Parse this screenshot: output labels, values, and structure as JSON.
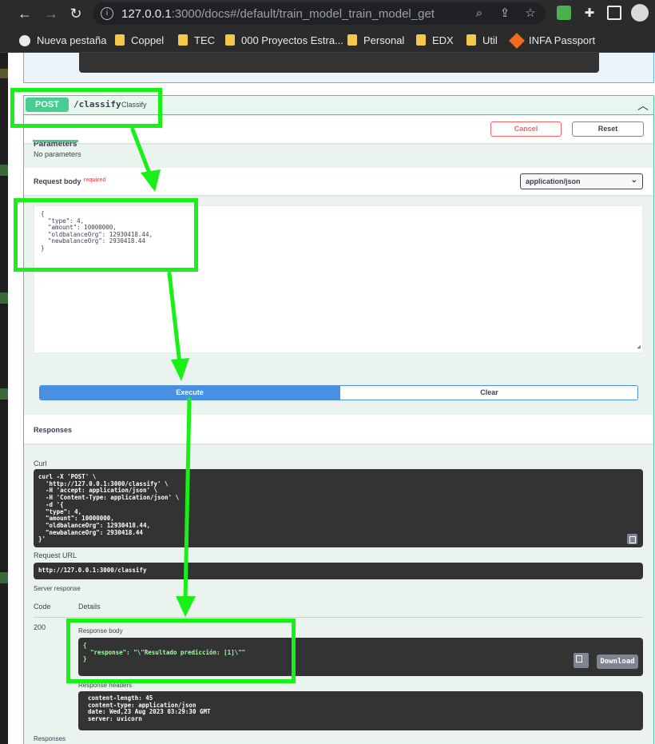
{
  "browser": {
    "url_host": "127.0.0.1",
    "url_rest": ":3000/docs#/default/train_model_train_model_get",
    "bookmarks": [
      {
        "label": "Nueva pestaña",
        "icon": "globe-icon"
      },
      {
        "label": "Coppel",
        "icon": "folder-icon"
      },
      {
        "label": "TEC",
        "icon": "folder-icon"
      },
      {
        "label": "000 Proyectos Estra...",
        "icon": "folder-icon"
      },
      {
        "label": "Personal",
        "icon": "folder-icon"
      },
      {
        "label": "EDX",
        "icon": "folder-icon"
      },
      {
        "label": "Util",
        "icon": "folder-icon"
      },
      {
        "label": "INFA Passport",
        "icon": "infa-icon"
      }
    ]
  },
  "operation": {
    "method": "POST",
    "path": "/classify",
    "summary": "Classify",
    "parameters_tab": "Parameters",
    "cancel_label": "Cancel",
    "reset_label": "Reset",
    "no_params": "No parameters",
    "request_body_label": "Request body",
    "required_label": "required",
    "content_type": "application/json",
    "request_body_text": "{\n  \"type\": 4,\n  \"amount\": 10000000,\n  \"oldbalanceOrg\": 12930418.44,\n  \"newbalanceOrg\": 2930418.44\n}",
    "execute_label": "Execute",
    "clear_label": "Clear"
  },
  "responses": {
    "title": "Responses",
    "curl_label": "Curl",
    "curl_text": "curl -X 'POST' \\\n  'http://127.0.0.1:3000/classify' \\\n  -H 'accept: application/json' \\\n  -H 'Content-Type: application/json' \\\n  -d '{\n  \"type\": 4,\n  \"amount\": 10000000,\n  \"oldbalanceOrg\": 12930418.44,\n  \"newbalanceOrg\": 2930418.44\n}'",
    "request_url_label": "Request URL",
    "request_url": "http://127.0.0.1:3000/classify",
    "server_response_label": "Server response",
    "code_header": "Code",
    "details_header": "Details",
    "code": "200",
    "response_body_label": "Response body",
    "response_body_text": "{\n  \"response\": \"\\\"Resultado predicción: [1]\\\"\"\n}",
    "download_label": "Download",
    "response_headers_label": "Response headers",
    "response_headers_text": "content-length: 45\ncontent-type: application/json\ndate: Wed,23 Aug 2023 03:29:30 GMT\nserver: uvicorn",
    "footer_label": "Responses"
  },
  "colors": {
    "post_green": "#49cc90",
    "annotation_green": "#18f018",
    "execute_blue": "#4990e2"
  }
}
